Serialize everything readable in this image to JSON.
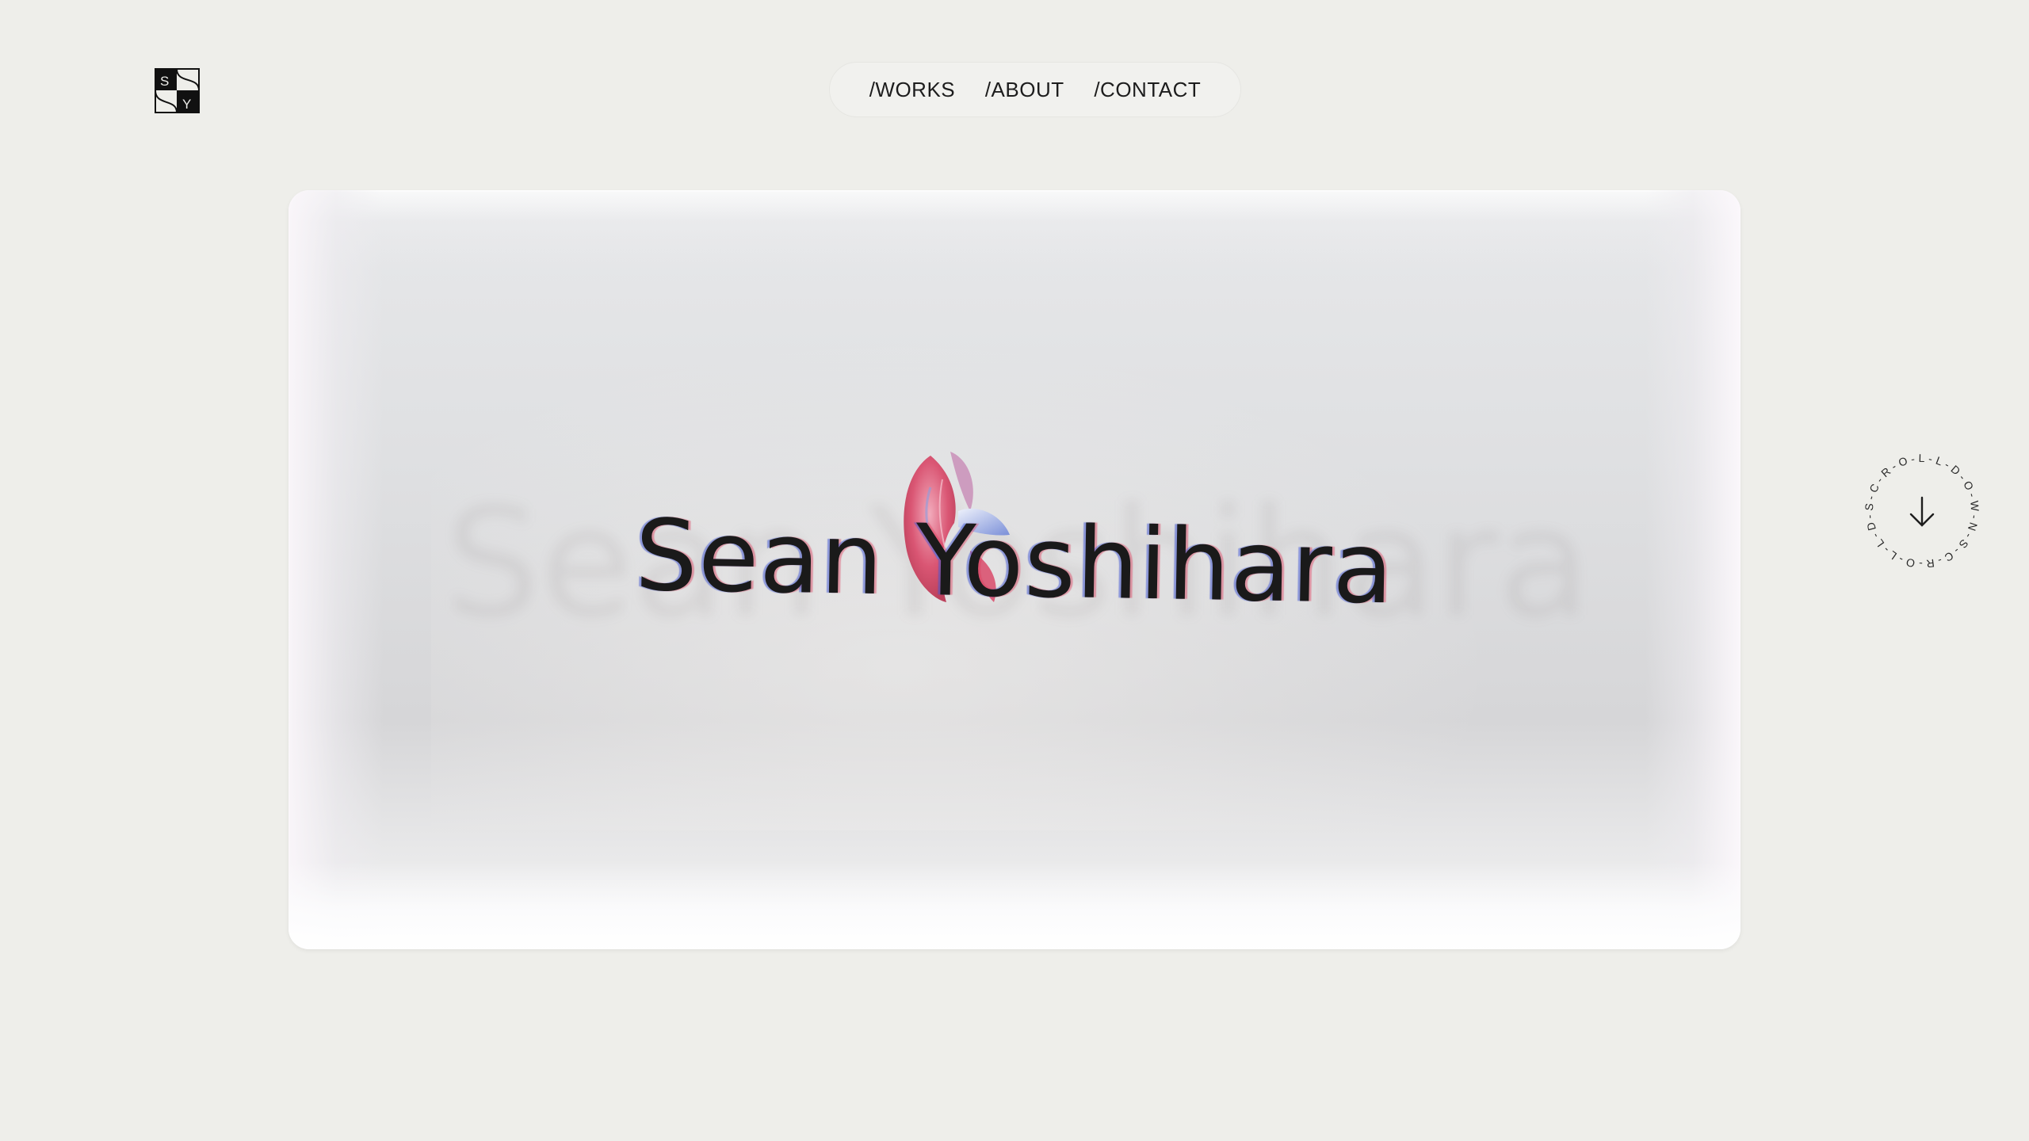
{
  "logo": {
    "letters": [
      "S",
      "Y"
    ],
    "icon": "monogram-sy-icon"
  },
  "nav": {
    "items": [
      {
        "label": "/WORKS"
      },
      {
        "label": "/ABOUT"
      },
      {
        "label": "/CONTACT"
      }
    ]
  },
  "hero": {
    "name": "Sean Yoshihara",
    "ornament": "betta-fish-illustration"
  },
  "scroll": {
    "ring_text": "S-C-R-O-L-L-D-O-W-N-S-C-R-O-L-L-D-O-W-N-",
    "icon": "arrow-down-icon"
  },
  "colors": {
    "background": "#eeeeea",
    "text": "#1d1d1d",
    "fish_red": "#d94a6a",
    "fish_blue": "#7a8fd8"
  }
}
